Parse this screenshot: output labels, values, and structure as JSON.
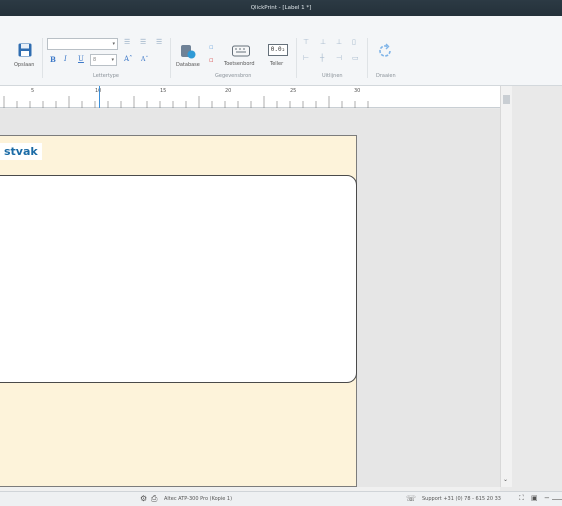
{
  "window": {
    "title": "QlickPrint - [Label 1 *]"
  },
  "ribbon": {
    "save_label": "Opslaan",
    "font_group_label": "Lettertype",
    "font_size_placeholder": "8",
    "bold": "B",
    "italic": "I",
    "underline": "U",
    "grow_font": "Aˆ",
    "shrink_font": "Aˇ",
    "database_label": "Database",
    "keyboard_label": "Toetsenbord",
    "counter_label": "Teller",
    "counter_icon_text": "0.0₂",
    "datasource_group_label": "Gegevensbron",
    "align_group_label": "Uitlijnen",
    "rotate_group_label": "Draaien"
  },
  "ruler": {
    "marks": [
      "5",
      "10",
      "15",
      "20",
      "25",
      "30"
    ]
  },
  "label": {
    "title_text": "stvak"
  },
  "statusbar": {
    "printer": "Altec ATP-300 Pro (Kopie 1)",
    "support": "Support +31 (0) 78 - 615 20 33"
  },
  "colors": {
    "title_bar": "#2c3a44",
    "label_bg": "#fdf3da",
    "accent": "#1b6ba6"
  }
}
